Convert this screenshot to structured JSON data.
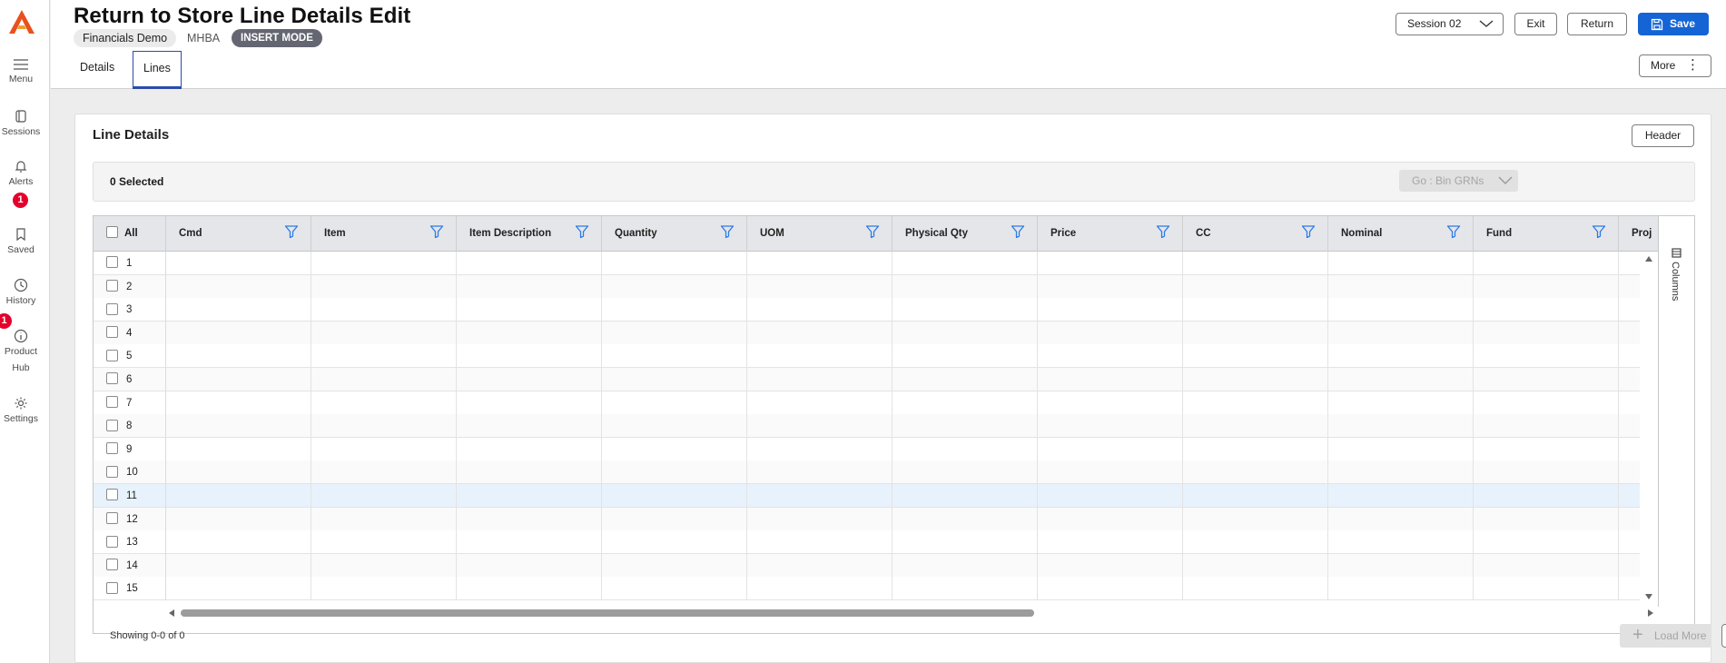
{
  "app": {
    "title": "Return to Store Line Details Edit",
    "org": "Financials Demo",
    "code": "MHBA",
    "mode": "INSERT MODE"
  },
  "colors": {
    "brand": "#e8511e",
    "primary": "#1564d6",
    "badge": "#e4002b",
    "tab_underline": "#2b4cab",
    "filter_icon": "#2c7be5"
  },
  "rail": {
    "menu": "Menu",
    "sessions": "Sessions",
    "alerts": "Alerts",
    "alerts_badge": "1",
    "saved": "Saved",
    "history": "History",
    "history_badge": "1",
    "product_hub_1": "Product",
    "product_hub_2": "Hub",
    "settings": "Settings"
  },
  "tabs": {
    "details": "Details",
    "lines": "Lines"
  },
  "toolbar": {
    "session": "Session 02",
    "exit": "Exit",
    "return": "Return",
    "save": "Save",
    "more": "More"
  },
  "card": {
    "title": "Line Details",
    "header_button": "Header",
    "selected": "0 Selected",
    "goto": "Go : Bin GRNs"
  },
  "grid": {
    "all_label": "All",
    "columns": [
      "Cmd",
      "Item",
      "Item Description",
      "Quantity",
      "UOM",
      "Physical Qty",
      "Price",
      "CC",
      "Nominal",
      "Fund",
      "Proj"
    ],
    "rows": [
      "1",
      "2",
      "3",
      "4",
      "5",
      "6",
      "7",
      "8",
      "9",
      "10",
      "11",
      "12",
      "13",
      "14",
      "15"
    ],
    "highlighted_row": "11",
    "side_panel": "Columns"
  },
  "footer": {
    "showing": "Showing 0-0 of 0",
    "load_more": "Load More"
  }
}
